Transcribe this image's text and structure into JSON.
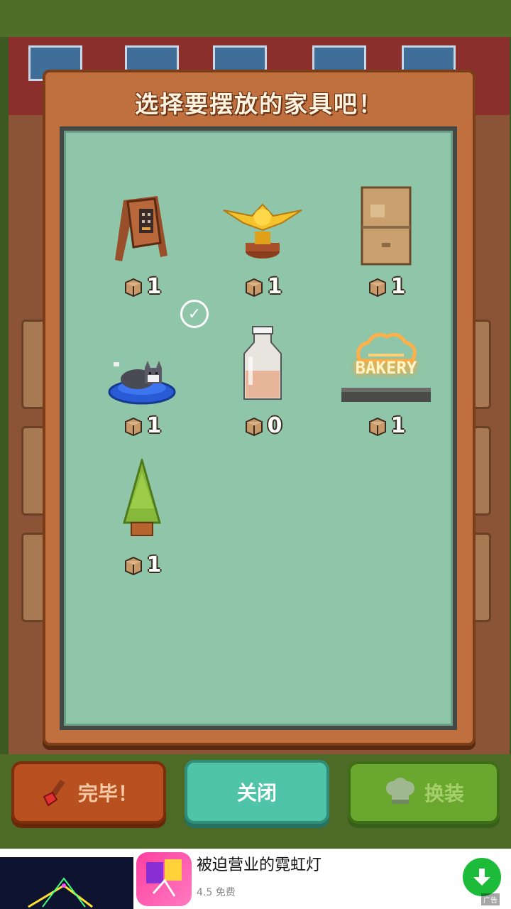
{
  "modal": {
    "title": "选择要摆放的家具吧！"
  },
  "items": [
    {
      "name": "sandwich-board-sign",
      "count": "1"
    },
    {
      "name": "golden-bird-trophy",
      "count": "1"
    },
    {
      "name": "cardboard-box",
      "count": "1"
    },
    {
      "name": "cat-bed",
      "count": "1"
    },
    {
      "name": "milk-bottle",
      "count": "0"
    },
    {
      "name": "bakery-neon-sign",
      "count": "1",
      "sign_text": "BAKERY"
    },
    {
      "name": "pine-tree",
      "count": "1"
    }
  ],
  "buttons": {
    "done_label": "完毕！",
    "close_label": "关闭",
    "dress_label": "换装"
  },
  "ad": {
    "title": "被迫营业的霓虹灯",
    "subtitle": "4.5 免费",
    "tag": "广告"
  },
  "colors": {
    "panel": "#8fc6a9",
    "modal": "#c0703e",
    "close_button": "#4fc4a8",
    "done_button": "#b9501f",
    "dress_button": "#6aa72e"
  }
}
